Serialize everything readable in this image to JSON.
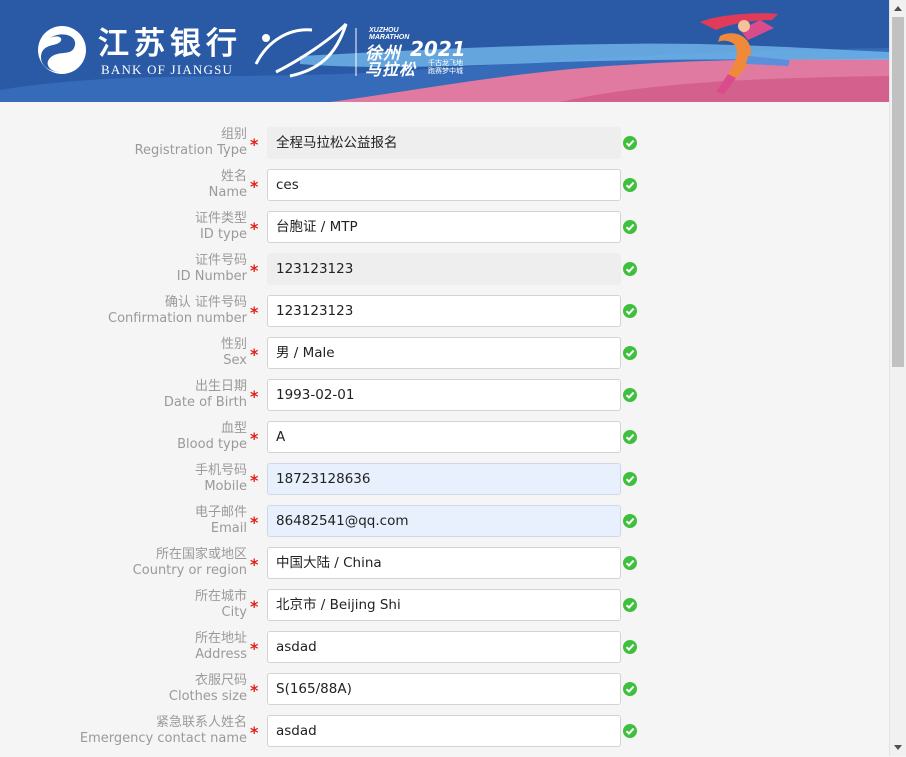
{
  "banner": {
    "bank_name_cn": "江苏银行",
    "bank_name_en": "BANK OF JIANGSU",
    "marathon_en": "XUZHOU MARATHON",
    "marathon_cn_top": "徐州",
    "marathon_year": "2021",
    "marathon_cn_bottom": "马拉松",
    "marathon_slogan": "千古龙飞地 跑赛梦中城",
    "colors": {
      "background": "#2a5aa6",
      "pink": "#e07aa0",
      "light_blue": "#6fb3e8"
    }
  },
  "form": {
    "fields": [
      {
        "label_cn": "组别",
        "label_en": "Registration Type",
        "value": "全程马拉松公益报名",
        "state": "readonly"
      },
      {
        "label_cn": "姓名",
        "label_en": "Name",
        "value": "ces",
        "state": "normal"
      },
      {
        "label_cn": "证件类型",
        "label_en": "ID type",
        "value": "台胞证 / MTP",
        "state": "normal"
      },
      {
        "label_cn": "证件号码",
        "label_en": "ID Number",
        "value": "123123123",
        "state": "readonly"
      },
      {
        "label_cn": "确认 证件号码",
        "label_en": "Confirmation number",
        "value": "123123123",
        "state": "normal"
      },
      {
        "label_cn": "性别",
        "label_en": "Sex",
        "value": "男 / Male",
        "state": "normal"
      },
      {
        "label_cn": "出生日期",
        "label_en": "Date of Birth",
        "value": "1993-02-01",
        "state": "normal"
      },
      {
        "label_cn": "血型",
        "label_en": "Blood type",
        "value": "A",
        "state": "normal"
      },
      {
        "label_cn": "手机号码",
        "label_en": "Mobile",
        "value": "18723128636",
        "state": "autofill"
      },
      {
        "label_cn": "电子邮件",
        "label_en": "Email",
        "value": "86482541@qq.com",
        "state": "autofill"
      },
      {
        "label_cn": "所在国家或地区",
        "label_en": "Country or region",
        "value": "中国大陆 / China",
        "state": "normal"
      },
      {
        "label_cn": "所在城市",
        "label_en": "City",
        "value": "北京市 / Beijing Shi",
        "state": "normal"
      },
      {
        "label_cn": "所在地址",
        "label_en": "Address",
        "value": "asdad",
        "state": "normal"
      },
      {
        "label_cn": "衣服尺码",
        "label_en": "Clothes size",
        "value": "S(165/88A)",
        "state": "normal"
      },
      {
        "label_cn": "紧急联系人姓名",
        "label_en": "Emergency contact name",
        "value": "asdad",
        "state": "normal"
      }
    ],
    "required_mark": "*",
    "valid_icon": "check-circle-icon",
    "colors": {
      "required": "#e0201b",
      "valid": "#3ebf3e",
      "label": "#9a9a9a"
    }
  }
}
